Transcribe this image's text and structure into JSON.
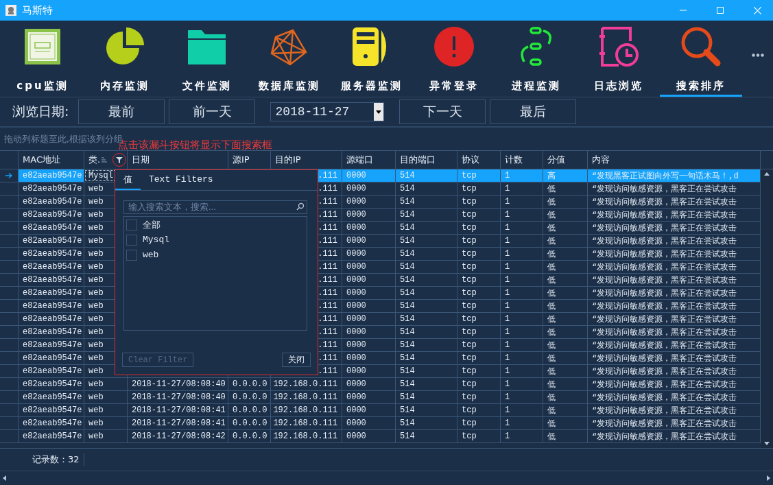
{
  "window": {
    "title": "马斯特"
  },
  "toolbar": [
    {
      "label": "cpu监测",
      "selected": false
    },
    {
      "label": "内存监测",
      "selected": false
    },
    {
      "label": "文件监测",
      "selected": false
    },
    {
      "label": "数据库监测",
      "selected": false
    },
    {
      "label": "服务器监测",
      "selected": false
    },
    {
      "label": "异常登录",
      "selected": false
    },
    {
      "label": "进程监测",
      "selected": false
    },
    {
      "label": "日志浏览",
      "selected": false
    },
    {
      "label": "搜索排序",
      "selected": true
    }
  ],
  "date_bar": {
    "label": "浏览日期:",
    "buttons_before": [
      "最前",
      "前一天"
    ],
    "date": "2018-11-27",
    "buttons_after": [
      "下一天",
      "最后"
    ]
  },
  "group_panel": {
    "hint": "拖动列标题至此,根据该列分组"
  },
  "annotation": "点击该漏斗按钮将显示下面搜索框",
  "table": {
    "columns": [
      "MAC地址",
      "类.",
      "日期",
      "源IP",
      "目的IP",
      "源端口",
      "目的端口",
      "协议",
      "计数",
      "分值",
      "内容"
    ],
    "rows": [
      {
        "selected": true,
        "type_cell_focused": true,
        "mac": "e82aeab9547e",
        "type": "Mysql",
        "dest_ip": ".111",
        "src_port": "0000",
        "dest_port": "514",
        "protocol": "tcp",
        "count": "1",
        "score": "高",
        "content": "“发现黑客正试图向外写一句话木马！,d"
      },
      {
        "selected": false,
        "mac": "e82aeab9547e",
        "type": "web",
        "dest_ip": ".111",
        "src_port": "0000",
        "dest_port": "514",
        "protocol": "tcp",
        "count": "1",
        "score": "低",
        "content": "“发现访问敏感资源，黑客正在尝试攻击"
      },
      {
        "selected": false,
        "mac": "e82aeab9547e",
        "type": "web",
        "dest_ip": ".111",
        "src_port": "0000",
        "dest_port": "514",
        "protocol": "tcp",
        "count": "1",
        "score": "低",
        "content": "“发现访问敏感资源，黑客正在尝试攻击"
      },
      {
        "selected": false,
        "mac": "e82aeab9547e",
        "type": "web",
        "dest_ip": ".111",
        "src_port": "0000",
        "dest_port": "514",
        "protocol": "tcp",
        "count": "1",
        "score": "低",
        "content": "“发现访问敏感资源，黑客正在尝试攻击"
      },
      {
        "selected": false,
        "mac": "e82aeab9547e",
        "type": "web",
        "dest_ip": ".111",
        "src_port": "0000",
        "dest_port": "514",
        "protocol": "tcp",
        "count": "1",
        "score": "低",
        "content": "“发现访问敏感资源，黑客正在尝试攻击"
      },
      {
        "selected": false,
        "mac": "e82aeab9547e",
        "type": "web",
        "dest_ip": ".111",
        "src_port": "0000",
        "dest_port": "514",
        "protocol": "tcp",
        "count": "1",
        "score": "低",
        "content": "“发现访问敏感资源，黑客正在尝试攻击"
      },
      {
        "selected": false,
        "mac": "e82aeab9547e",
        "type": "web",
        "dest_ip": ".111",
        "src_port": "0000",
        "dest_port": "514",
        "protocol": "tcp",
        "count": "1",
        "score": "低",
        "content": "“发现访问敏感资源，黑客正在尝试攻击"
      },
      {
        "selected": false,
        "mac": "e82aeab9547e",
        "type": "web",
        "dest_ip": ".111",
        "src_port": "0000",
        "dest_port": "514",
        "protocol": "tcp",
        "count": "1",
        "score": "低",
        "content": "“发现访问敏感资源，黑客正在尝试攻击"
      },
      {
        "selected": false,
        "mac": "e82aeab9547e",
        "type": "web",
        "dest_ip": ".111",
        "src_port": "0000",
        "dest_port": "514",
        "protocol": "tcp",
        "count": "1",
        "score": "低",
        "content": "“发现访问敏感资源，黑客正在尝试攻击"
      },
      {
        "selected": false,
        "mac": "e82aeab9547e",
        "type": "web",
        "dest_ip": ".111",
        "src_port": "0000",
        "dest_port": "514",
        "protocol": "tcp",
        "count": "1",
        "score": "低",
        "content": "“发现访问敏感资源，黑客正在尝试攻击"
      },
      {
        "selected": false,
        "mac": "e82aeab9547e",
        "type": "web",
        "dest_ip": ".111",
        "src_port": "0000",
        "dest_port": "514",
        "protocol": "tcp",
        "count": "1",
        "score": "低",
        "content": "“发现访问敏感资源，黑客正在尝试攻击"
      },
      {
        "selected": false,
        "mac": "e82aeab9547e",
        "type": "web",
        "dest_ip": ".111",
        "src_port": "0000",
        "dest_port": "514",
        "protocol": "tcp",
        "count": "1",
        "score": "低",
        "content": "“发现访问敏感资源，黑客正在尝试攻击"
      },
      {
        "selected": false,
        "mac": "e82aeab9547e",
        "type": "web",
        "dest_ip": ".111",
        "src_port": "0000",
        "dest_port": "514",
        "protocol": "tcp",
        "count": "1",
        "score": "低",
        "content": "“发现访问敏感资源，黑客正在尝试攻击"
      },
      {
        "selected": false,
        "mac": "e82aeab9547e",
        "type": "web",
        "dest_ip": ".111",
        "src_port": "0000",
        "dest_port": "514",
        "protocol": "tcp",
        "count": "1",
        "score": "低",
        "content": "“发现访问敏感资源，黑客正在尝试攻击"
      },
      {
        "selected": false,
        "mac": "e82aeab9547e",
        "type": "web",
        "dest_ip": ".111",
        "src_port": "0000",
        "dest_port": "514",
        "protocol": "tcp",
        "count": "1",
        "score": "低",
        "content": "“发现访问敏感资源，黑客正在尝试攻击"
      },
      {
        "selected": false,
        "mac": "e82aeab9547e",
        "type": "web",
        "dest_ip": ".111",
        "src_port": "0000",
        "dest_port": "514",
        "protocol": "tcp",
        "count": "1",
        "score": "低",
        "content": "“发现访问敏感资源，黑客正在尝试攻击"
      },
      {
        "selected": false,
        "mac": "e82aeab9547e",
        "type": "web",
        "date": "2018-11-27/08:08:40",
        "src_ip": "0.0.0.0",
        "dest_ip": "192.168.0.111",
        "src_port": "0000",
        "dest_port": "514",
        "protocol": "tcp",
        "count": "1",
        "score": "低",
        "content": "“发现访问敏感资源，黑客正在尝试攻击"
      },
      {
        "selected": false,
        "mac": "e82aeab9547e",
        "type": "web",
        "date": "2018-11-27/08:08:40",
        "src_ip": "0.0.0.0",
        "dest_ip": "192.168.0.111",
        "src_port": "0000",
        "dest_port": "514",
        "protocol": "tcp",
        "count": "1",
        "score": "低",
        "content": "“发现访问敏感资源，黑客正在尝试攻击"
      },
      {
        "selected": false,
        "mac": "e82aeab9547e",
        "type": "web",
        "date": "2018-11-27/08:08:41",
        "src_ip": "0.0.0.0",
        "dest_ip": "192.168.0.111",
        "src_port": "0000",
        "dest_port": "514",
        "protocol": "tcp",
        "count": "1",
        "score": "低",
        "content": "“发现访问敏感资源，黑客正在尝试攻击"
      },
      {
        "selected": false,
        "mac": "e82aeab9547e",
        "type": "web",
        "date": "2018-11-27/08:08:41",
        "src_ip": "0.0.0.0",
        "dest_ip": "192.168.0.111",
        "src_port": "0000",
        "dest_port": "514",
        "protocol": "tcp",
        "count": "1",
        "score": "低",
        "content": "“发现访问敏感资源，黑客正在尝试攻击"
      },
      {
        "selected": false,
        "mac": "e82aeab9547e",
        "type": "web",
        "date": "2018-11-27/08:08:42",
        "src_ip": "0.0.0.0",
        "dest_ip": "192.168.0.111",
        "src_port": "0000",
        "dest_port": "514",
        "protocol": "tcp",
        "count": "1",
        "score": "低",
        "content": "“发现访问敏感资源，黑客正在尝试攻击"
      }
    ]
  },
  "filter_popup": {
    "tabs": [
      {
        "label": "值",
        "selected": true
      },
      {
        "label": "Text Filters",
        "selected": false
      }
    ],
    "search": {
      "placeholder": "输入搜索文本，搜索..."
    },
    "options": [
      {
        "label": "全部",
        "checked": false
      },
      {
        "label": "Mysql",
        "checked": false
      },
      {
        "label": "web",
        "checked": false
      }
    ],
    "clear_button": {
      "label": "Clear Filter",
      "disabled": true
    },
    "close_button": {
      "label": "关闭"
    }
  },
  "status_bar": {
    "record_count": "记录数：32"
  }
}
